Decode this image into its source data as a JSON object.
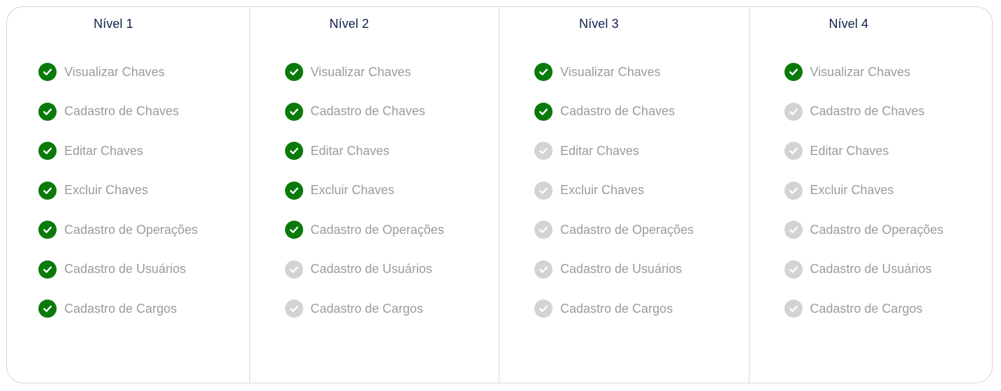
{
  "colors": {
    "enabled_check": "#0a7a0a",
    "disabled_check": "#d3d3d3",
    "title": "#0f1f4a",
    "label": "#9b9b9b",
    "border": "#d6d6d6"
  },
  "levels": [
    {
      "title": "Nível 1",
      "permissions": [
        {
          "label": "Visualizar Chaves",
          "enabled": true,
          "icon": "check-circle-icon"
        },
        {
          "label": "Cadastro de Chaves",
          "enabled": true,
          "icon": "check-circle-icon"
        },
        {
          "label": "Editar Chaves",
          "enabled": true,
          "icon": "check-circle-icon"
        },
        {
          "label": "Excluir Chaves",
          "enabled": true,
          "icon": "check-circle-icon"
        },
        {
          "label": "Cadastro de Operações",
          "enabled": true,
          "icon": "check-circle-icon"
        },
        {
          "label": "Cadastro de Usuários",
          "enabled": true,
          "icon": "check-circle-icon"
        },
        {
          "label": "Cadastro de Cargos",
          "enabled": true,
          "icon": "check-circle-icon"
        }
      ]
    },
    {
      "title": "Nível 2",
      "permissions": [
        {
          "label": "Visualizar Chaves",
          "enabled": true,
          "icon": "check-circle-icon"
        },
        {
          "label": "Cadastro de Chaves",
          "enabled": true,
          "icon": "check-circle-icon"
        },
        {
          "label": "Editar Chaves",
          "enabled": true,
          "icon": "check-circle-icon"
        },
        {
          "label": "Excluir Chaves",
          "enabled": true,
          "icon": "check-circle-icon"
        },
        {
          "label": "Cadastro de Operações",
          "enabled": true,
          "icon": "check-circle-icon"
        },
        {
          "label": "Cadastro de Usuários",
          "enabled": false,
          "icon": "check-circle-icon"
        },
        {
          "label": "Cadastro de Cargos",
          "enabled": false,
          "icon": "check-circle-icon"
        }
      ]
    },
    {
      "title": "Nível 3",
      "permissions": [
        {
          "label": "Visualizar Chaves",
          "enabled": true,
          "icon": "check-circle-icon"
        },
        {
          "label": "Cadastro de Chaves",
          "enabled": true,
          "icon": "check-circle-icon"
        },
        {
          "label": "Editar Chaves",
          "enabled": false,
          "icon": "check-circle-icon"
        },
        {
          "label": "Excluir Chaves",
          "enabled": false,
          "icon": "check-circle-icon"
        },
        {
          "label": "Cadastro de Operações",
          "enabled": false,
          "icon": "check-circle-icon"
        },
        {
          "label": "Cadastro de Usuários",
          "enabled": false,
          "icon": "check-circle-icon"
        },
        {
          "label": "Cadastro de Cargos",
          "enabled": false,
          "icon": "check-circle-icon"
        }
      ]
    },
    {
      "title": "Nível 4",
      "permissions": [
        {
          "label": "Visualizar Chaves",
          "enabled": true,
          "icon": "check-circle-icon"
        },
        {
          "label": "Cadastro de Chaves",
          "enabled": false,
          "icon": "check-circle-icon"
        },
        {
          "label": "Editar Chaves",
          "enabled": false,
          "icon": "check-circle-icon"
        },
        {
          "label": "Excluir Chaves",
          "enabled": false,
          "icon": "check-circle-icon"
        },
        {
          "label": "Cadastro de Operações",
          "enabled": false,
          "icon": "check-circle-icon"
        },
        {
          "label": "Cadastro de Usuários",
          "enabled": false,
          "icon": "check-circle-icon"
        },
        {
          "label": "Cadastro de Cargos",
          "enabled": false,
          "icon": "check-circle-icon"
        }
      ]
    }
  ]
}
